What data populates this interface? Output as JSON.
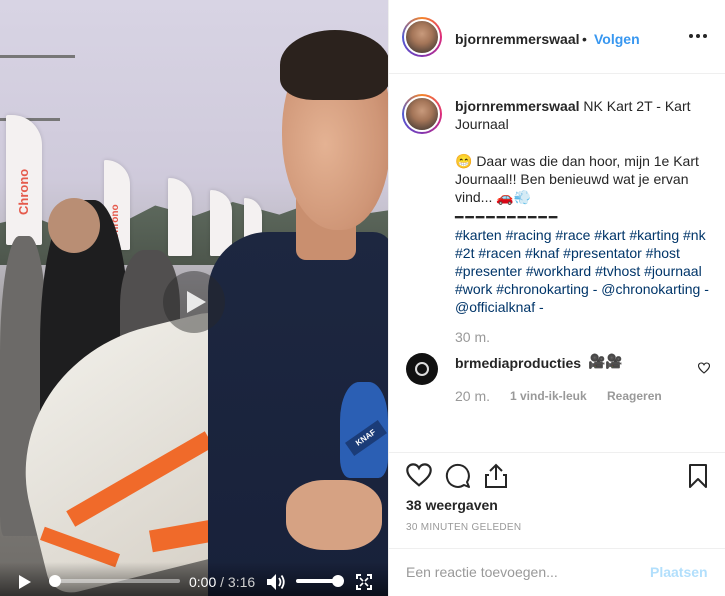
{
  "video": {
    "current_time": "0:00",
    "separator": "/",
    "total_time": "3:16",
    "progress_fraction": 0,
    "volume_fraction": 0.85,
    "mic_brand": "KNAF",
    "flag_text": "Chrono"
  },
  "post": {
    "author": "bjornremmerswaal",
    "follow_dot": "•",
    "follow_label": "Volgen",
    "caption_title": "NK Kart 2T - Kart Journaal",
    "caption_body": "😁 Daar was die dan hoor, mijn 1e Kart Journaal!! Ben benieuwd wat je ervan vind... 🚗💨",
    "divider": "━━━━━━━━━━",
    "hashtags": "#karten #racing #race #kart #karting #nk #2t #racen #knaf #presentator #host #presenter #workhard #tvhost #journaal #work #chronokarting - @chronokarting - @officialknaf -",
    "caption_time": "30 m."
  },
  "comment": {
    "user": "brmediaproducties",
    "text": "🎥🎥",
    "time": "20 m.",
    "likes": "1 vind-ik-leuk",
    "reply": "Reageren"
  },
  "stats": {
    "views": "38 weergaven",
    "timestamp": "30 MINUTEN GELEDEN"
  },
  "comment_box": {
    "placeholder": "Een reactie toevoegen...",
    "post_label": "Plaatsen"
  },
  "colors": {
    "link_blue": "#3897f0",
    "hashtag_blue": "#003569",
    "muted": "#999999",
    "post_disabled": "#b2dffc"
  }
}
